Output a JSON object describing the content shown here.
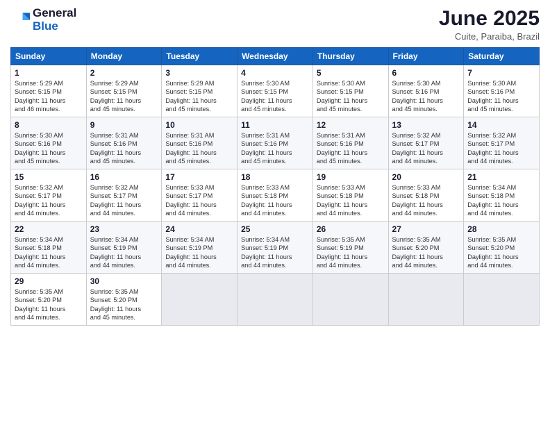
{
  "logo": {
    "line1": "General",
    "line2": "Blue"
  },
  "title": "June 2025",
  "location": "Cuite, Paraiba, Brazil",
  "headers": [
    "Sunday",
    "Monday",
    "Tuesday",
    "Wednesday",
    "Thursday",
    "Friday",
    "Saturday"
  ],
  "weeks": [
    [
      {
        "day": "1",
        "info": "Sunrise: 5:29 AM\nSunset: 5:15 PM\nDaylight: 11 hours\nand 46 minutes."
      },
      {
        "day": "2",
        "info": "Sunrise: 5:29 AM\nSunset: 5:15 PM\nDaylight: 11 hours\nand 45 minutes."
      },
      {
        "day": "3",
        "info": "Sunrise: 5:29 AM\nSunset: 5:15 PM\nDaylight: 11 hours\nand 45 minutes."
      },
      {
        "day": "4",
        "info": "Sunrise: 5:30 AM\nSunset: 5:15 PM\nDaylight: 11 hours\nand 45 minutes."
      },
      {
        "day": "5",
        "info": "Sunrise: 5:30 AM\nSunset: 5:15 PM\nDaylight: 11 hours\nand 45 minutes."
      },
      {
        "day": "6",
        "info": "Sunrise: 5:30 AM\nSunset: 5:16 PM\nDaylight: 11 hours\nand 45 minutes."
      },
      {
        "day": "7",
        "info": "Sunrise: 5:30 AM\nSunset: 5:16 PM\nDaylight: 11 hours\nand 45 minutes."
      }
    ],
    [
      {
        "day": "8",
        "info": "Sunrise: 5:30 AM\nSunset: 5:16 PM\nDaylight: 11 hours\nand 45 minutes."
      },
      {
        "day": "9",
        "info": "Sunrise: 5:31 AM\nSunset: 5:16 PM\nDaylight: 11 hours\nand 45 minutes."
      },
      {
        "day": "10",
        "info": "Sunrise: 5:31 AM\nSunset: 5:16 PM\nDaylight: 11 hours\nand 45 minutes."
      },
      {
        "day": "11",
        "info": "Sunrise: 5:31 AM\nSunset: 5:16 PM\nDaylight: 11 hours\nand 45 minutes."
      },
      {
        "day": "12",
        "info": "Sunrise: 5:31 AM\nSunset: 5:16 PM\nDaylight: 11 hours\nand 45 minutes."
      },
      {
        "day": "13",
        "info": "Sunrise: 5:32 AM\nSunset: 5:17 PM\nDaylight: 11 hours\nand 44 minutes."
      },
      {
        "day": "14",
        "info": "Sunrise: 5:32 AM\nSunset: 5:17 PM\nDaylight: 11 hours\nand 44 minutes."
      }
    ],
    [
      {
        "day": "15",
        "info": "Sunrise: 5:32 AM\nSunset: 5:17 PM\nDaylight: 11 hours\nand 44 minutes."
      },
      {
        "day": "16",
        "info": "Sunrise: 5:32 AM\nSunset: 5:17 PM\nDaylight: 11 hours\nand 44 minutes."
      },
      {
        "day": "17",
        "info": "Sunrise: 5:33 AM\nSunset: 5:17 PM\nDaylight: 11 hours\nand 44 minutes."
      },
      {
        "day": "18",
        "info": "Sunrise: 5:33 AM\nSunset: 5:18 PM\nDaylight: 11 hours\nand 44 minutes."
      },
      {
        "day": "19",
        "info": "Sunrise: 5:33 AM\nSunset: 5:18 PM\nDaylight: 11 hours\nand 44 minutes."
      },
      {
        "day": "20",
        "info": "Sunrise: 5:33 AM\nSunset: 5:18 PM\nDaylight: 11 hours\nand 44 minutes."
      },
      {
        "day": "21",
        "info": "Sunrise: 5:34 AM\nSunset: 5:18 PM\nDaylight: 11 hours\nand 44 minutes."
      }
    ],
    [
      {
        "day": "22",
        "info": "Sunrise: 5:34 AM\nSunset: 5:18 PM\nDaylight: 11 hours\nand 44 minutes."
      },
      {
        "day": "23",
        "info": "Sunrise: 5:34 AM\nSunset: 5:19 PM\nDaylight: 11 hours\nand 44 minutes."
      },
      {
        "day": "24",
        "info": "Sunrise: 5:34 AM\nSunset: 5:19 PM\nDaylight: 11 hours\nand 44 minutes."
      },
      {
        "day": "25",
        "info": "Sunrise: 5:34 AM\nSunset: 5:19 PM\nDaylight: 11 hours\nand 44 minutes."
      },
      {
        "day": "26",
        "info": "Sunrise: 5:35 AM\nSunset: 5:19 PM\nDaylight: 11 hours\nand 44 minutes."
      },
      {
        "day": "27",
        "info": "Sunrise: 5:35 AM\nSunset: 5:20 PM\nDaylight: 11 hours\nand 44 minutes."
      },
      {
        "day": "28",
        "info": "Sunrise: 5:35 AM\nSunset: 5:20 PM\nDaylight: 11 hours\nand 44 minutes."
      }
    ],
    [
      {
        "day": "29",
        "info": "Sunrise: 5:35 AM\nSunset: 5:20 PM\nDaylight: 11 hours\nand 44 minutes."
      },
      {
        "day": "30",
        "info": "Sunrise: 5:35 AM\nSunset: 5:20 PM\nDaylight: 11 hours\nand 45 minutes."
      },
      {
        "day": "",
        "info": ""
      },
      {
        "day": "",
        "info": ""
      },
      {
        "day": "",
        "info": ""
      },
      {
        "day": "",
        "info": ""
      },
      {
        "day": "",
        "info": ""
      }
    ]
  ]
}
